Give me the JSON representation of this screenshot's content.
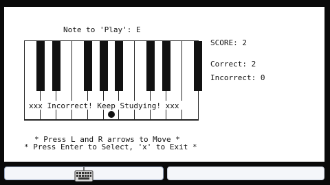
{
  "game": {
    "note_prompt": "Note to 'Play': E",
    "score": "SCORE: 2",
    "correct": "Correct: 2",
    "incorrect": "Incorrect: 0",
    "feedback": "xxx Incorrect! Keep Studying! xxx",
    "instructions": {
      "line1": "* Press L and R arrows to Move *",
      "line2": "* Press Enter to Select, 'x' to Exit *"
    },
    "keyboard": {
      "white_keys": 11,
      "black_keys_after_white": [
        0,
        1,
        3,
        4,
        5,
        7,
        8,
        10
      ],
      "cursor_white_key": 5
    }
  },
  "taskbar": {
    "icons": [
      "keyboard-icon"
    ]
  }
}
